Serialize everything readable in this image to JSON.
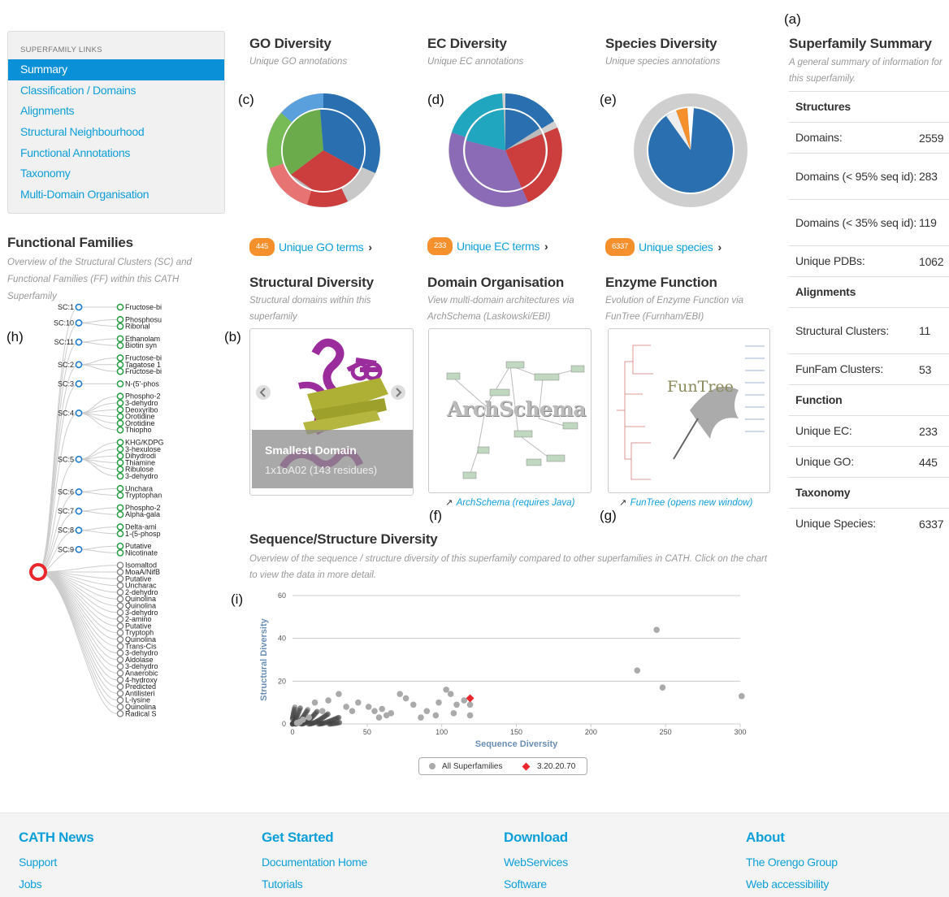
{
  "panel_labels": {
    "a": "(a)",
    "b": "(b)",
    "c": "(c)",
    "d": "(d)",
    "e": "(e)",
    "f": "(f)",
    "g": "(g)",
    "h": "(h)",
    "i": "(i)"
  },
  "sidebar": {
    "heading": "SUPERFAMILY LINKS",
    "items": [
      {
        "label": "Summary",
        "active": true
      },
      {
        "label": "Classification / Domains"
      },
      {
        "label": "Alignments"
      },
      {
        "label": "Structural Neighbourhood"
      },
      {
        "label": "Functional Annotations"
      },
      {
        "label": "Taxonomy"
      },
      {
        "label": "Multi-Domain Organisation"
      }
    ]
  },
  "functional_families": {
    "title": "Functional Families",
    "subtitle": "Overview of the Structural Clusters (SC) and Functional Families (FF) within this CATH Superfamily",
    "clusters": [
      {
        "label": "SC:1",
        "leaves": [
          "Fructose-bi"
        ]
      },
      {
        "label": "SC:10",
        "leaves": [
          "Phosphosu",
          "Ribonal"
        ]
      },
      {
        "label": "SC:11",
        "leaves": [
          "Ethanolam",
          "Biotin syn"
        ]
      },
      {
        "label": "SC:2",
        "leaves": [
          "Fructose-bi",
          "Tagatose 1",
          "Fructose-bi"
        ]
      },
      {
        "label": "SC:3",
        "leaves": [
          "N-(5'-phos"
        ]
      },
      {
        "label": "SC:4",
        "leaves": [
          "Phospho-2",
          "3-dehydro",
          "Deoxyribo",
          "Orotidine",
          "Orotidine",
          "Thiopho"
        ]
      },
      {
        "label": "SC:5",
        "leaves": [
          "KHG/KDPG",
          "3-hexulose",
          "Dihydrodi",
          "Thiamine",
          "Ribulose",
          "3-dehydro"
        ]
      },
      {
        "label": "SC:6",
        "leaves": [
          "Unchara",
          "Tryptophan"
        ]
      },
      {
        "label": "SC:7",
        "leaves": [
          "Phospho-2",
          "Alpha-gala"
        ]
      },
      {
        "label": "SC:8",
        "leaves": [
          "Delta-ami",
          "1-(5-phosp"
        ]
      },
      {
        "label": "SC:9",
        "leaves": [
          "Putative",
          "Nicotinate"
        ]
      }
    ],
    "ff_leaves": [
      "Isomaltod",
      "MoaA/NifB",
      "Putative",
      "Uncharac",
      "2-dehydro",
      "Quinolina",
      "Quinolina",
      "3-dehydro",
      "2-amino",
      "Putative",
      "Tryptoph",
      "Quinolina",
      "Trans-Cis",
      "3-dehydro",
      "Aldolase",
      "3-dehydro",
      "Anaerobic",
      "4-hydroxy",
      "Predicted",
      "Antilisteri",
      "L-lysine",
      "Quinolina",
      "Radical S"
    ]
  },
  "go_diversity": {
    "title": "GO Diversity",
    "subtitle": "Unique GO annotations",
    "count": "445",
    "link": "Unique GO terms",
    "chevron": "›"
  },
  "ec_diversity": {
    "title": "EC Diversity",
    "subtitle": "Unique EC annotations",
    "count": "233",
    "link": "Unique EC terms",
    "chevron": "›"
  },
  "species_diversity": {
    "title": "Species Diversity",
    "subtitle": "Unique species annotations",
    "count": "6337",
    "link": "Unique species",
    "chevron": "›"
  },
  "structural_diversity": {
    "title": "Structural Diversity",
    "subtitle": "Structural domains within this superfamily",
    "caption_title": "Smallest Domain",
    "caption_detail": "1x1oA02 (143 residues)"
  },
  "domain_organisation": {
    "title": "Domain Organisation",
    "subtitle": "View multi-domain architectures via ArchSchema (Laskowski/EBI)",
    "image_text": "ArchSchema",
    "link": "ArchSchema (requires Java)"
  },
  "enzyme_function": {
    "title": "Enzyme Function",
    "subtitle": "Evolution of Enzyme Function via FunTree (Furnham/EBI)",
    "image_text": "FunTree",
    "link": "FunTree (opens new window)"
  },
  "summary": {
    "title": "Superfamily Summary",
    "subtitle": "A general summary of information for this superfamily.",
    "rows": [
      {
        "k": "Structures",
        "v": "",
        "section": true
      },
      {
        "k": "Domains:",
        "v": "2559"
      },
      {
        "k": "Domains (< 95% seq id):",
        "v": "283"
      },
      {
        "k": "Domains (< 35% seq id):",
        "v": "119"
      },
      {
        "k": "Unique PDBs:",
        "v": "1062"
      },
      {
        "k": "Alignments",
        "v": "",
        "section": true
      },
      {
        "k": "Structural Clusters:",
        "v": "11"
      },
      {
        "k": "FunFam Clusters:",
        "v": "53"
      },
      {
        "k": "Function",
        "v": "",
        "section": true
      },
      {
        "k": "Unique EC:",
        "v": "233"
      },
      {
        "k": "Unique GO:",
        "v": "445"
      },
      {
        "k": "Taxonomy",
        "v": "",
        "section": true
      },
      {
        "k": "Unique Species:",
        "v": "6337"
      }
    ]
  },
  "seq_struct": {
    "title": "Sequence/Structure Diversity",
    "subtitle": "Overview of the sequence / structure diversity of this superfamily compared to other superfamilies in CATH. Click on the chart to view the data in more detail."
  },
  "chart_data": {
    "type": "scatter",
    "xlabel": "Sequence Diversity",
    "ylabel": "Structural Diversity",
    "xlim": [
      0,
      300
    ],
    "ylim": [
      0,
      60
    ],
    "xticks": [
      "0",
      "50",
      "100",
      "150",
      "200",
      "250",
      "300"
    ],
    "yticks": [
      "0",
      "20",
      "40",
      "60"
    ],
    "grid": true,
    "legend_position": "bottom",
    "series": [
      {
        "name": "All Superfamilies",
        "color": "#aaaaaa",
        "points": [
          [
            244,
            44
          ],
          [
            231,
            25
          ],
          [
            248,
            17
          ],
          [
            301,
            13
          ],
          [
            15,
            10
          ],
          [
            24,
            11
          ],
          [
            31,
            14
          ],
          [
            44,
            10
          ],
          [
            51,
            8
          ],
          [
            60,
            7
          ],
          [
            72,
            14
          ],
          [
            76,
            12
          ],
          [
            81,
            9
          ],
          [
            98,
            10
          ],
          [
            103,
            16
          ],
          [
            106,
            14
          ],
          [
            110,
            9
          ],
          [
            115,
            11
          ],
          [
            119,
            9
          ],
          [
            108,
            5
          ],
          [
            90,
            6
          ],
          [
            66,
            5
          ],
          [
            40,
            6
          ],
          [
            58,
            3
          ],
          [
            63,
            4
          ],
          [
            86,
            3
          ],
          [
            96,
            4
          ],
          [
            119,
            4
          ],
          [
            55,
            6
          ],
          [
            36,
            8
          ],
          [
            20,
            6
          ],
          [
            11,
            3
          ],
          [
            7,
            2
          ],
          [
            5,
            1
          ],
          [
            3,
            0.5
          ]
        ]
      },
      {
        "name": "3.20.20.70",
        "color": "#e8262b",
        "points": [
          [
            119,
            12
          ]
        ]
      }
    ]
  },
  "footer": {
    "columns": [
      {
        "title": "CATH News",
        "links": [
          "Support",
          "Jobs"
        ]
      },
      {
        "title": "Get Started",
        "links": [
          "Documentation Home",
          "Tutorials"
        ]
      },
      {
        "title": "Download",
        "links": [
          "WebServices",
          "Software"
        ]
      },
      {
        "title": "About",
        "links": [
          "The Orengo Group",
          "Web accessibility"
        ]
      }
    ]
  },
  "colors": {
    "accent": "#0d9fd8",
    "active": "#0a90d6",
    "badge": "#f5902d",
    "go_blue": "#2a6fb0",
    "go_red": "#cc3e3e",
    "go_green": "#6cab4b",
    "ec_purple": "#8b6bb5",
    "ec_teal": "#20a6bf"
  }
}
